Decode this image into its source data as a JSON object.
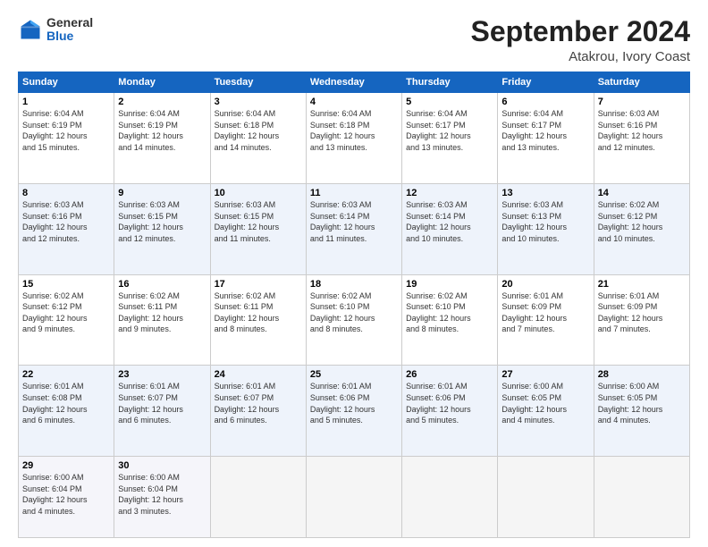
{
  "logo": {
    "general": "General",
    "blue": "Blue"
  },
  "title": "September 2024",
  "location": "Atakrou, Ivory Coast",
  "days_header": [
    "Sunday",
    "Monday",
    "Tuesday",
    "Wednesday",
    "Thursday",
    "Friday",
    "Saturday"
  ],
  "weeks": [
    [
      {
        "day": "1",
        "info": "Sunrise: 6:04 AM\nSunset: 6:19 PM\nDaylight: 12 hours\nand 15 minutes."
      },
      {
        "day": "2",
        "info": "Sunrise: 6:04 AM\nSunset: 6:19 PM\nDaylight: 12 hours\nand 14 minutes."
      },
      {
        "day": "3",
        "info": "Sunrise: 6:04 AM\nSunset: 6:18 PM\nDaylight: 12 hours\nand 14 minutes."
      },
      {
        "day": "4",
        "info": "Sunrise: 6:04 AM\nSunset: 6:18 PM\nDaylight: 12 hours\nand 13 minutes."
      },
      {
        "day": "5",
        "info": "Sunrise: 6:04 AM\nSunset: 6:17 PM\nDaylight: 12 hours\nand 13 minutes."
      },
      {
        "day": "6",
        "info": "Sunrise: 6:04 AM\nSunset: 6:17 PM\nDaylight: 12 hours\nand 13 minutes."
      },
      {
        "day": "7",
        "info": "Sunrise: 6:03 AM\nSunset: 6:16 PM\nDaylight: 12 hours\nand 12 minutes."
      }
    ],
    [
      {
        "day": "8",
        "info": "Sunrise: 6:03 AM\nSunset: 6:16 PM\nDaylight: 12 hours\nand 12 minutes."
      },
      {
        "day": "9",
        "info": "Sunrise: 6:03 AM\nSunset: 6:15 PM\nDaylight: 12 hours\nand 12 minutes."
      },
      {
        "day": "10",
        "info": "Sunrise: 6:03 AM\nSunset: 6:15 PM\nDaylight: 12 hours\nand 11 minutes."
      },
      {
        "day": "11",
        "info": "Sunrise: 6:03 AM\nSunset: 6:14 PM\nDaylight: 12 hours\nand 11 minutes."
      },
      {
        "day": "12",
        "info": "Sunrise: 6:03 AM\nSunset: 6:14 PM\nDaylight: 12 hours\nand 10 minutes."
      },
      {
        "day": "13",
        "info": "Sunrise: 6:03 AM\nSunset: 6:13 PM\nDaylight: 12 hours\nand 10 minutes."
      },
      {
        "day": "14",
        "info": "Sunrise: 6:02 AM\nSunset: 6:12 PM\nDaylight: 12 hours\nand 10 minutes."
      }
    ],
    [
      {
        "day": "15",
        "info": "Sunrise: 6:02 AM\nSunset: 6:12 PM\nDaylight: 12 hours\nand 9 minutes."
      },
      {
        "day": "16",
        "info": "Sunrise: 6:02 AM\nSunset: 6:11 PM\nDaylight: 12 hours\nand 9 minutes."
      },
      {
        "day": "17",
        "info": "Sunrise: 6:02 AM\nSunset: 6:11 PM\nDaylight: 12 hours\nand 8 minutes."
      },
      {
        "day": "18",
        "info": "Sunrise: 6:02 AM\nSunset: 6:10 PM\nDaylight: 12 hours\nand 8 minutes."
      },
      {
        "day": "19",
        "info": "Sunrise: 6:02 AM\nSunset: 6:10 PM\nDaylight: 12 hours\nand 8 minutes."
      },
      {
        "day": "20",
        "info": "Sunrise: 6:01 AM\nSunset: 6:09 PM\nDaylight: 12 hours\nand 7 minutes."
      },
      {
        "day": "21",
        "info": "Sunrise: 6:01 AM\nSunset: 6:09 PM\nDaylight: 12 hours\nand 7 minutes."
      }
    ],
    [
      {
        "day": "22",
        "info": "Sunrise: 6:01 AM\nSunset: 6:08 PM\nDaylight: 12 hours\nand 6 minutes."
      },
      {
        "day": "23",
        "info": "Sunrise: 6:01 AM\nSunset: 6:07 PM\nDaylight: 12 hours\nand 6 minutes."
      },
      {
        "day": "24",
        "info": "Sunrise: 6:01 AM\nSunset: 6:07 PM\nDaylight: 12 hours\nand 6 minutes."
      },
      {
        "day": "25",
        "info": "Sunrise: 6:01 AM\nSunset: 6:06 PM\nDaylight: 12 hours\nand 5 minutes."
      },
      {
        "day": "26",
        "info": "Sunrise: 6:01 AM\nSunset: 6:06 PM\nDaylight: 12 hours\nand 5 minutes."
      },
      {
        "day": "27",
        "info": "Sunrise: 6:00 AM\nSunset: 6:05 PM\nDaylight: 12 hours\nand 4 minutes."
      },
      {
        "day": "28",
        "info": "Sunrise: 6:00 AM\nSunset: 6:05 PM\nDaylight: 12 hours\nand 4 minutes."
      }
    ],
    [
      {
        "day": "29",
        "info": "Sunrise: 6:00 AM\nSunset: 6:04 PM\nDaylight: 12 hours\nand 4 minutes."
      },
      {
        "day": "30",
        "info": "Sunrise: 6:00 AM\nSunset: 6:04 PM\nDaylight: 12 hours\nand 3 minutes."
      },
      {
        "day": "",
        "info": ""
      },
      {
        "day": "",
        "info": ""
      },
      {
        "day": "",
        "info": ""
      },
      {
        "day": "",
        "info": ""
      },
      {
        "day": "",
        "info": ""
      }
    ]
  ]
}
